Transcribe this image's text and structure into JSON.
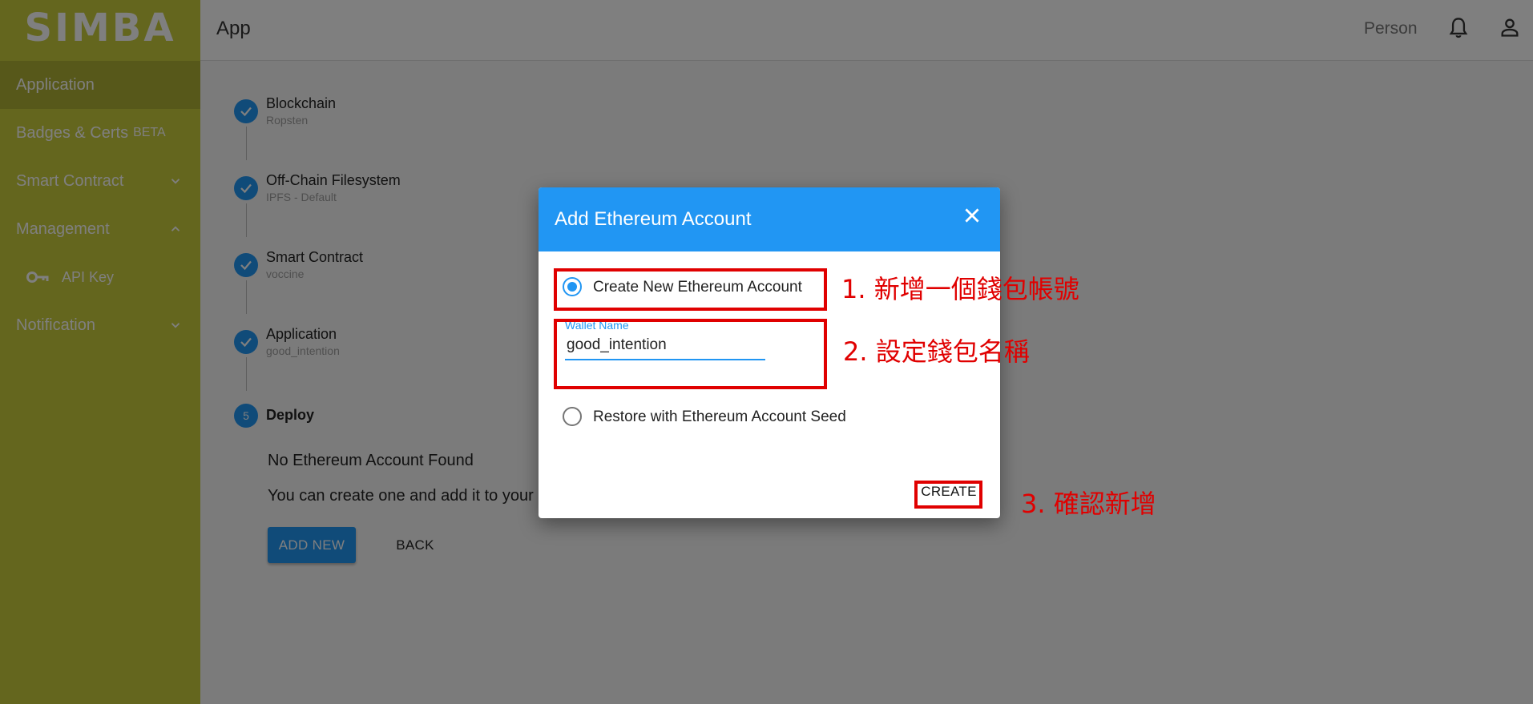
{
  "sidebar": {
    "logo": "SIMBA",
    "items": [
      {
        "label": "Application"
      },
      {
        "label": "Badges & Certs",
        "badge": "BETA"
      },
      {
        "label": "Smart Contract"
      },
      {
        "label": "Management"
      },
      {
        "label": "API Key"
      },
      {
        "label": "Notification"
      }
    ]
  },
  "appbar": {
    "title": "App",
    "person": "Person"
  },
  "stepper": {
    "steps": [
      {
        "title": "Blockchain",
        "subtitle": "Ropsten"
      },
      {
        "title": "Off-Chain Filesystem",
        "subtitle": "IPFS - Default"
      },
      {
        "title": "Smart Contract",
        "subtitle": "voccine"
      },
      {
        "title": "Application",
        "subtitle": "good_intention"
      },
      {
        "number": "5",
        "title": "Deploy"
      }
    ],
    "message_title": "No Ethereum Account Found",
    "message_body": "You can create one and add it to your l",
    "add_new_label": "ADD NEW",
    "back_label": "BACK"
  },
  "dialog": {
    "title": "Add Ethereum Account",
    "option_create": "Create New Ethereum Account",
    "wallet_label": "Wallet Name",
    "wallet_value": "good_intention",
    "option_restore": "Restore with Ethereum Account Seed",
    "create_label": "CREATE"
  },
  "annotations": {
    "step1": "1. 新增一個錢包帳號",
    "step2": "2. 設定錢包名稱",
    "step3": "3. 確認新增",
    "color": "#e00000"
  },
  "colors": {
    "sidebar": "#c8cc3c",
    "sidebar_active": "#aeb035",
    "primary": "#2196f3"
  }
}
